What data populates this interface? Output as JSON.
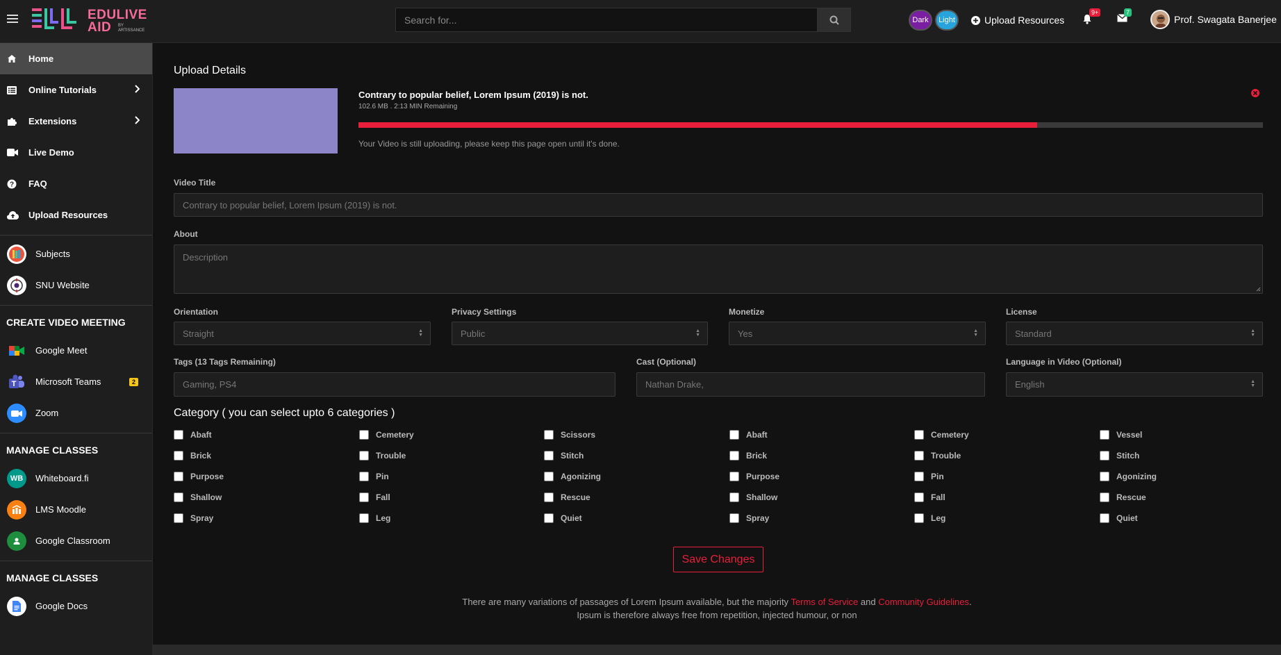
{
  "brand": {
    "line1": "EDULIVE",
    "line2": "AID",
    "by": "BY ARTISSANCE"
  },
  "search": {
    "placeholder": "Search for..."
  },
  "header": {
    "theme_dark": "Dark",
    "theme_light": "Light",
    "upload_resources": "Upload Resources",
    "notif_badge": "9+",
    "mail_badge": "7",
    "user_name": "Prof. Swagata Banerjee"
  },
  "sidebar": {
    "nav": [
      {
        "label": "Home",
        "icon": "home-icon"
      },
      {
        "label": "Online Tutorials",
        "icon": "list-icon"
      },
      {
        "label": "Extensions",
        "icon": "puzzle-icon"
      },
      {
        "label": "Live Demo",
        "icon": "video-icon"
      },
      {
        "label": "FAQ",
        "icon": "question-icon"
      },
      {
        "label": "Upload Resources",
        "icon": "cloud-upload-icon"
      }
    ],
    "links": [
      {
        "label": "Subjects"
      },
      {
        "label": "SNU Website"
      }
    ],
    "meeting_head": "CREATE VIDEO MEETING",
    "meetings": [
      {
        "label": "Google Meet"
      },
      {
        "label": "Microsoft Teams",
        "badge": "2"
      },
      {
        "label": "Zoom"
      }
    ],
    "classes_head": "MANAGE CLASSES",
    "classes": [
      {
        "label": "Whiteboard.fi"
      },
      {
        "label": "LMS Moodle"
      },
      {
        "label": "Google Classroom"
      }
    ],
    "classes_head2": "MANAGE CLASSES",
    "docs": [
      {
        "label": "Google Docs"
      }
    ]
  },
  "upload": {
    "heading": "Upload Details",
    "file_title": "Contrary to popular belief, Lorem Ipsum (2019) is not.",
    "file_meta": "102.6 MB . 2:13 MIN Remaining",
    "progress": 0.75,
    "note": "Your Video is still uploading, please keep this page open until it's done."
  },
  "form": {
    "video_title_label": "Video Title",
    "video_title_value": "Contrary to popular belief, Lorem Ipsum (2019) is not.",
    "about_label": "About",
    "about_placeholder": "Description",
    "orientation_label": "Orientation",
    "orientation_value": "Straight",
    "privacy_label": "Privacy Settings",
    "privacy_value": "Public",
    "monetize_label": "Monetize",
    "monetize_value": "Yes",
    "license_label": "License",
    "license_value": "Standard",
    "tags_label": "Tags (13 Tags Remaining)",
    "tags_value": "Gaming, PS4",
    "cast_label": "Cast (Optional)",
    "cast_value": "Nathan Drake,",
    "language_label": "Language in Video (Optional)",
    "language_value": "English"
  },
  "category": {
    "heading": "Category ( you can select upto 6 categories )",
    "columns": [
      [
        "Abaft",
        "Brick",
        "Purpose",
        "Shallow",
        "Spray"
      ],
      [
        "Cemetery",
        "Trouble",
        "Pin",
        "Fall",
        "Leg"
      ],
      [
        "Scissors",
        "Stitch",
        "Agonizing",
        "Rescue",
        "Quiet"
      ],
      [
        "Abaft",
        "Brick",
        "Purpose",
        "Shallow",
        "Spray"
      ],
      [
        "Cemetery",
        "Trouble",
        "Pin",
        "Fall",
        "Leg"
      ],
      [
        "Vessel",
        "Stitch",
        "Agonizing",
        "Rescue",
        "Quiet"
      ]
    ]
  },
  "save_label": "Save Changes",
  "footer": {
    "line1_pre": "There are many variations of passages of Lorem Ipsum available, but the majority",
    "terms": "Terms of Service",
    "and": "and",
    "guidelines": "Community Guidelines",
    "period": ".",
    "line2": "Ipsum is therefore always free from repetition, injected humour, or non"
  },
  "colors": {
    "accent": "#e91e3a",
    "sidebar_bg": "#1e1e1e",
    "main_bg": "#121212",
    "thumb": "#8c85c8"
  }
}
